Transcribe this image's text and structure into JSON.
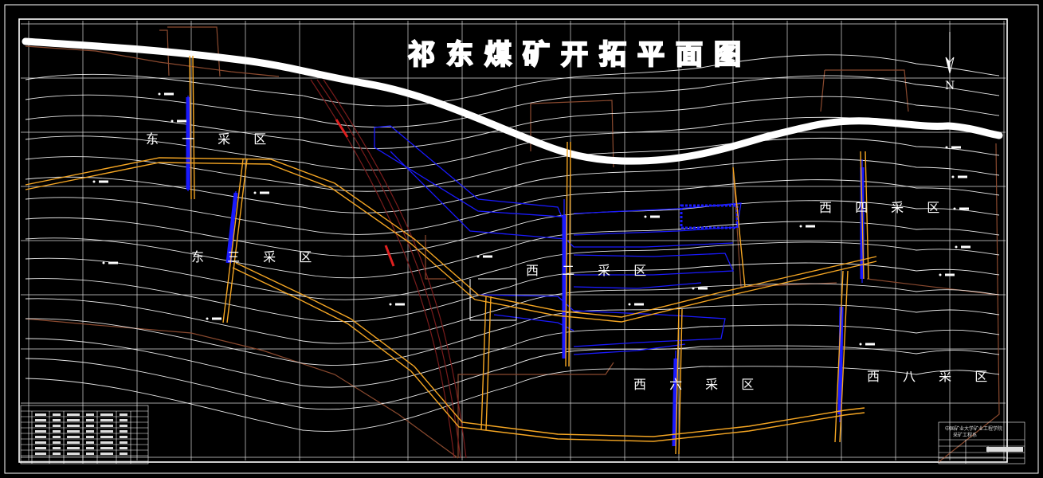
{
  "title": "祁东煤矿开拓平面图",
  "north_label": "N",
  "zones": [
    {
      "id": "east-1",
      "label": "东 一 采 区"
    },
    {
      "id": "east-3",
      "label": "东 三 采 区"
    },
    {
      "id": "west-2",
      "label": "西 二 采 区"
    },
    {
      "id": "west-4",
      "label": "西 四 采 区"
    },
    {
      "id": "west-6",
      "label": "西 六 采 区"
    },
    {
      "id": "west-8",
      "label": "西 八 采 区"
    }
  ],
  "title_block": {
    "line1": "中国矿业大学矿业工程学院",
    "line2": "采矿工程系"
  },
  "colors": {
    "background": "#000000",
    "grid": "#ffffff",
    "contour": "#ffffff",
    "roadway": "#f5a623",
    "workings": "#1a1aff",
    "boundary": "#8b4a2f",
    "fault": "#b22222",
    "river": "#ffffff"
  }
}
